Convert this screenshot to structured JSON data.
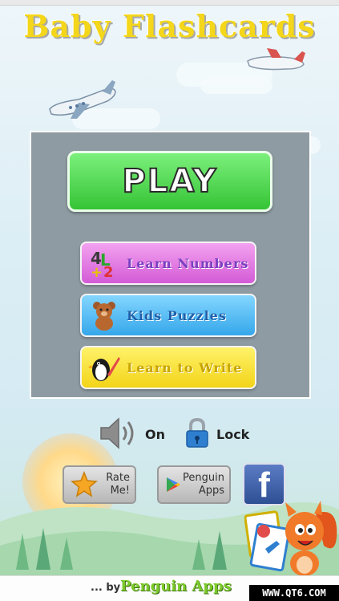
{
  "app": {
    "title": "Baby Flashcards"
  },
  "menu": {
    "play_label": "PLAY",
    "buttons": [
      {
        "label": "Learn Numbers",
        "icon": "numbers-blocks-icon"
      },
      {
        "label": "Kids Puzzles",
        "icon": "teddy-bear-icon"
      },
      {
        "label": "Learn to Write",
        "icon": "penguin-pencil-icon"
      }
    ]
  },
  "controls": {
    "sound_label": "On",
    "lock_label": "Lock"
  },
  "bottom": {
    "rate_label_1": "Rate",
    "rate_label_2": "Me!",
    "apps_label_1": "Penguin",
    "apps_label_2": "Apps",
    "facebook_letter": "f"
  },
  "footer": {
    "by_text": "... by",
    "logo_text": "Penguin Apps",
    "watermark": "WWW.QT6.COM"
  },
  "colors": {
    "title": "#f4d61a",
    "play": "#35c435",
    "numbers": "#d35bd6",
    "puzzles": "#35a7ea",
    "write": "#f2d418"
  }
}
